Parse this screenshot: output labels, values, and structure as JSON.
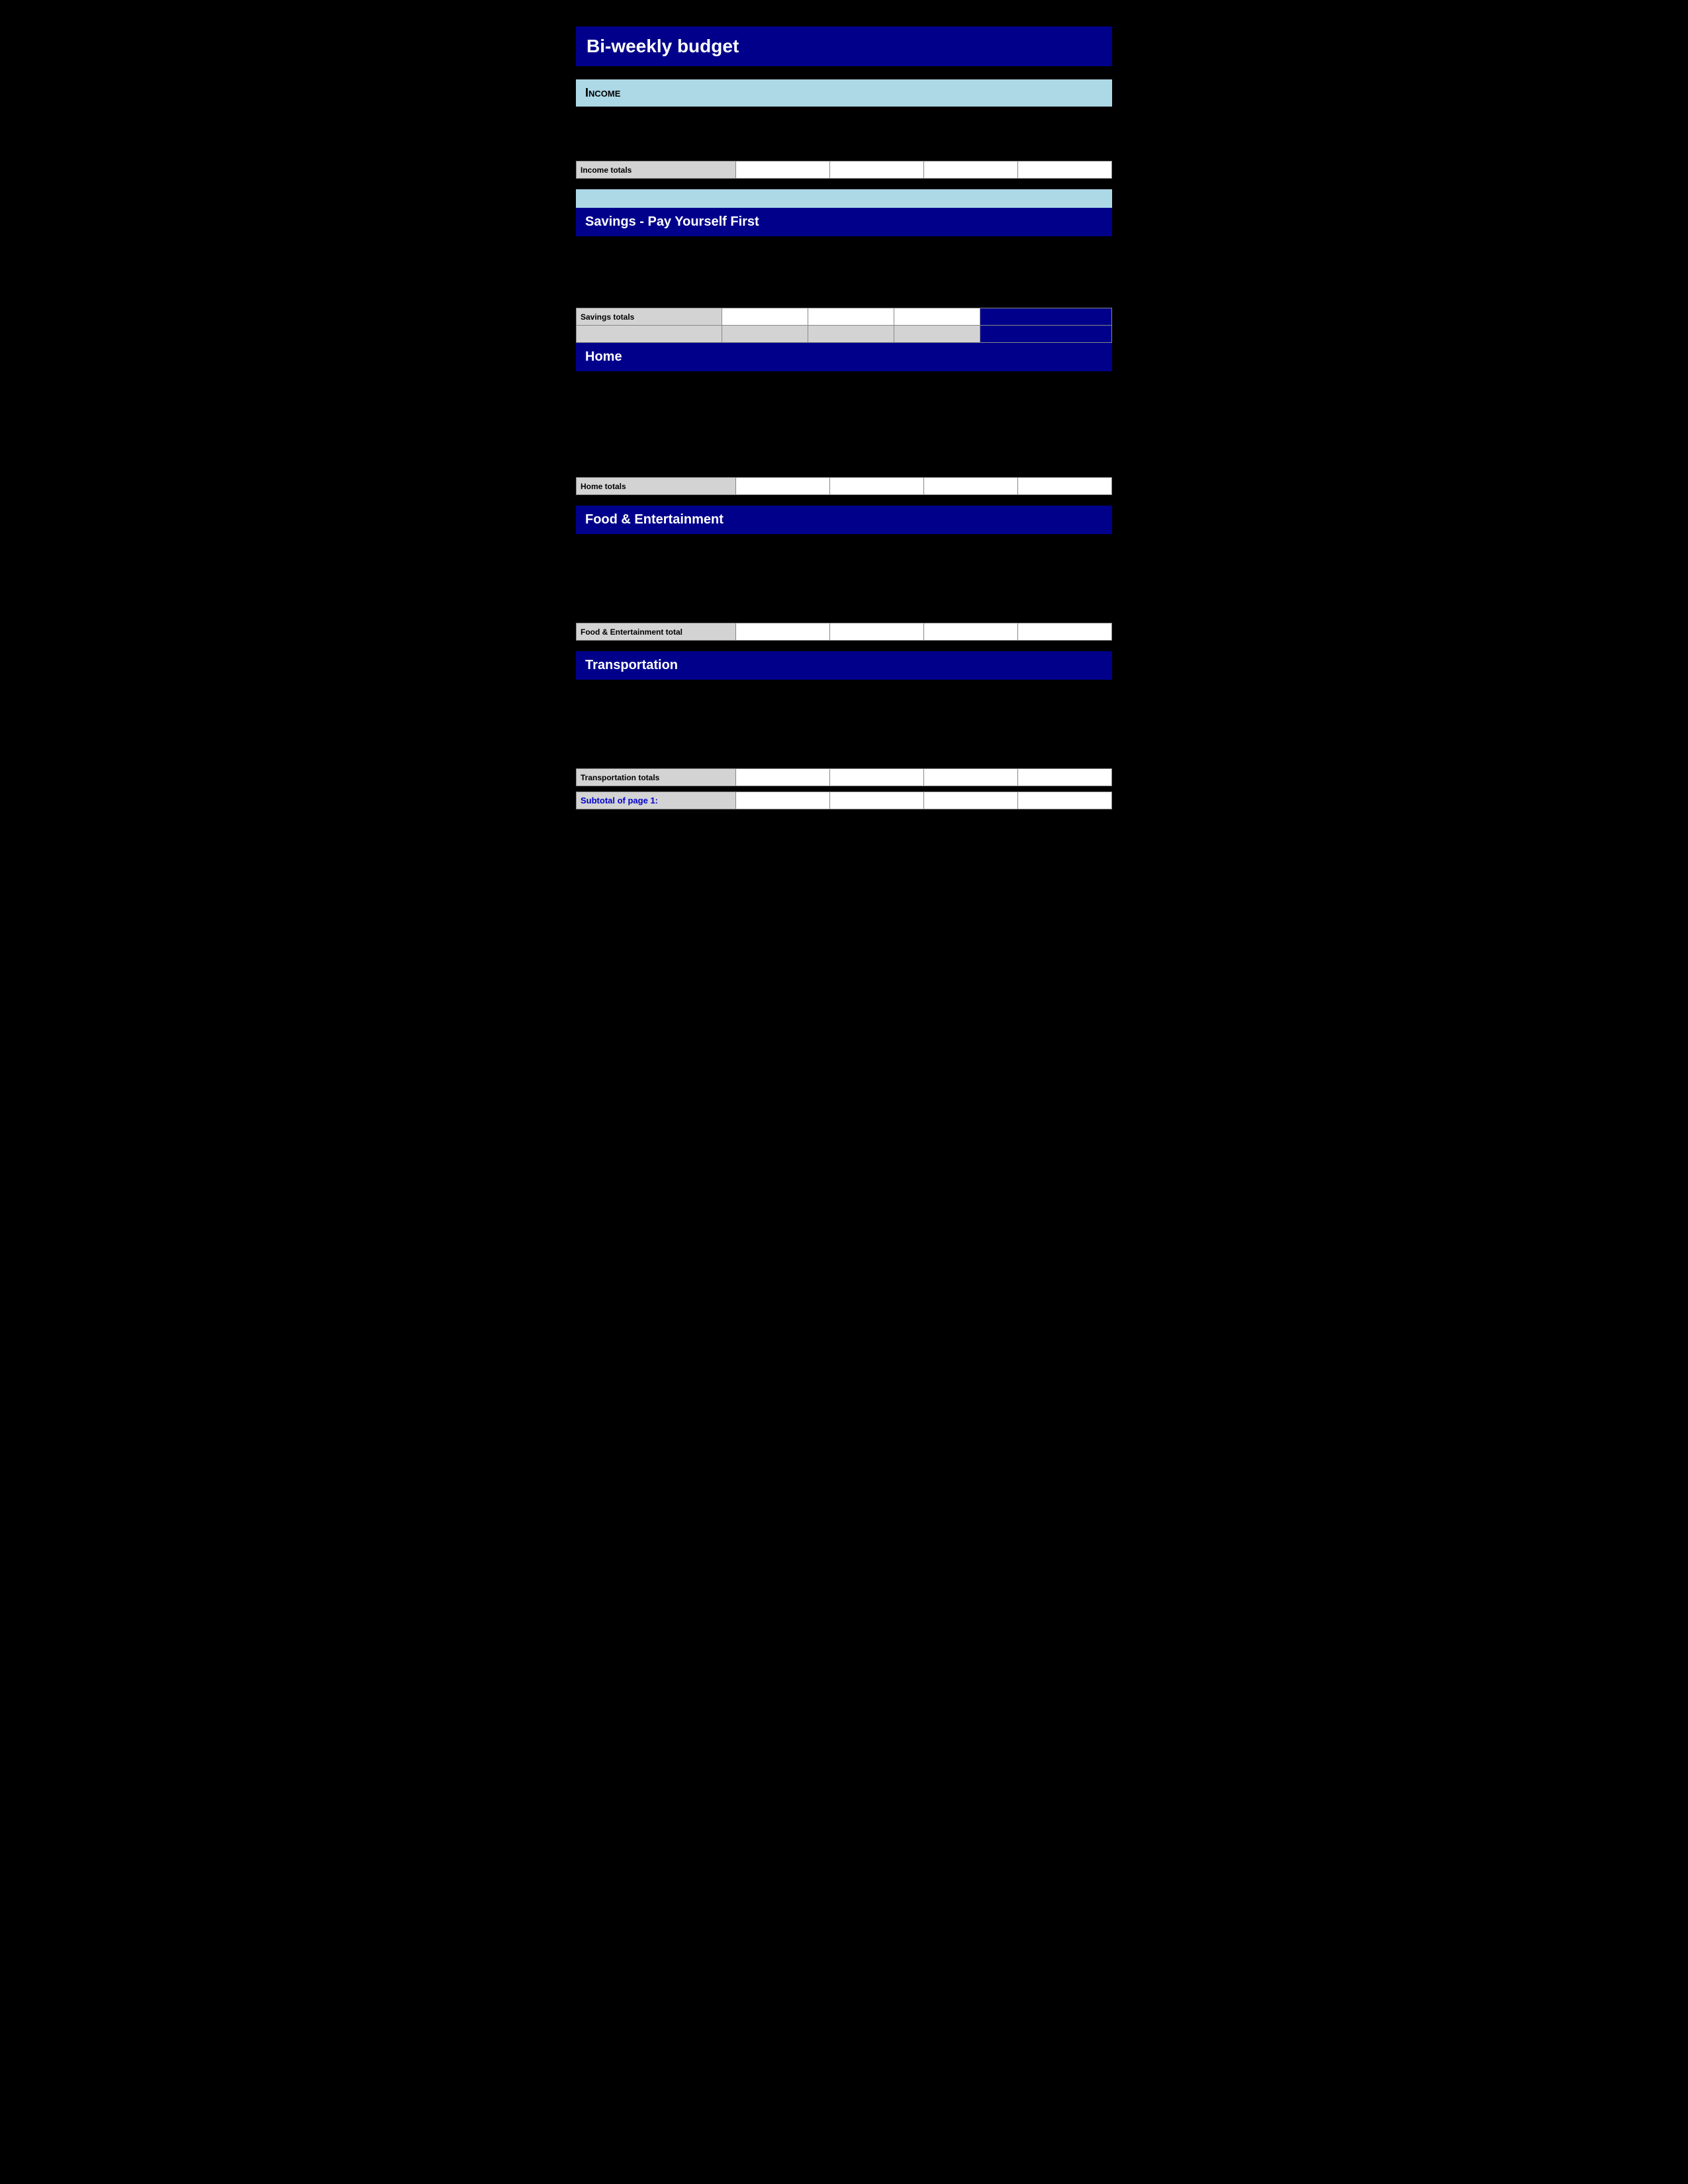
{
  "page": {
    "title": "Bi-weekly  budget"
  },
  "sections": {
    "income": {
      "header": "Income",
      "totals_label": "Income totals",
      "empty_rows": 3
    },
    "savings": {
      "header": "Savings - Pay Yourself First",
      "totals_label": "Savings totals",
      "empty_rows": 4
    },
    "home": {
      "header": "Home",
      "totals_label": "Home totals",
      "empty_rows": 6
    },
    "food": {
      "header": "Food & Entertainment",
      "totals_label": "Food & Entertainment total",
      "empty_rows": 5
    },
    "transportation": {
      "header": "Transportation",
      "totals_label": "Transportation totals",
      "empty_rows": 5
    },
    "subtotal": {
      "label": "Subtotal of page 1:"
    }
  },
  "columns": {
    "count": 4,
    "widths": [
      "220px",
      "130px",
      "130px",
      "130px",
      "130px"
    ]
  }
}
